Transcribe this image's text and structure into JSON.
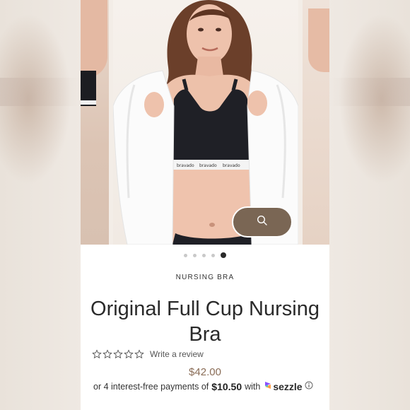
{
  "product": {
    "category": "NURSING BRA",
    "title": "Original Full Cup Nursing Bra",
    "brand_band_text": "bravado",
    "review_link": "Write a review",
    "rating_stars": 0,
    "price": "$42.00",
    "installments": {
      "prefix": "or 4 interest-free payments of",
      "amount": "$10.50",
      "with_text": "with",
      "provider": "sezzle"
    }
  },
  "carousel": {
    "total_slides": 5,
    "active_slide": 5
  },
  "colors": {
    "price": "#8a6d57",
    "zoom_button": "#7a6654",
    "active_dot": "#2a2a2a",
    "inactive_dot": "#c9c9c9"
  },
  "icons": {
    "zoom": "search-icon",
    "star": "star-outline-icon",
    "sezzle": "sezzle-logo-icon",
    "info": "info-icon"
  }
}
